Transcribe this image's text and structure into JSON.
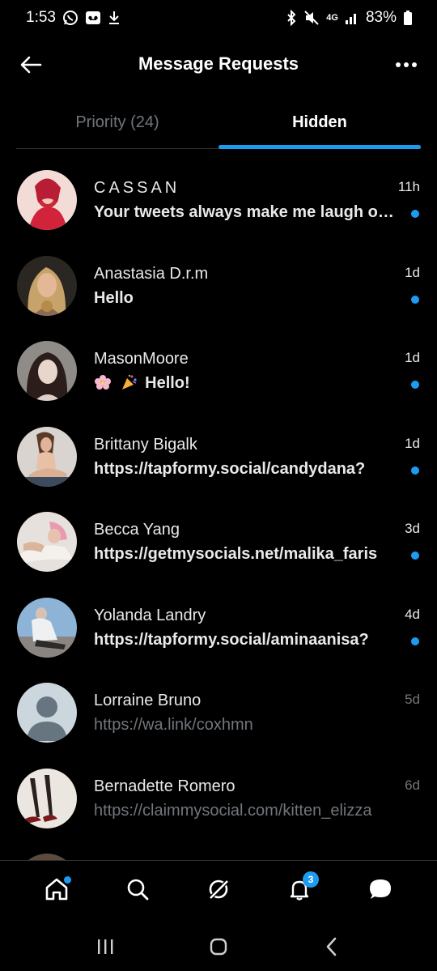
{
  "status_bar": {
    "time": "1:53",
    "network": "4G",
    "battery": "83%",
    "icons": [
      "whatsapp-icon",
      "voicemail-icon",
      "download-icon",
      "bluetooth-icon",
      "mute-icon",
      "signal-icon",
      "battery-icon"
    ]
  },
  "header": {
    "title": "Message Requests",
    "back_icon": "back-arrow-icon",
    "more_icon": "more-options-icon"
  },
  "tabs": [
    {
      "label": "Priority (24)",
      "active": false
    },
    {
      "label": "Hidden",
      "active": true
    }
  ],
  "requests": [
    {
      "name": "CASSAN",
      "time": "11h",
      "preview": "Your tweets always make me laugh out loud",
      "unread": true
    },
    {
      "name": "Anastasia D.r.m",
      "time": "1d",
      "preview": "Hello",
      "unread": true
    },
    {
      "name": "MasonMoore",
      "time": "1d",
      "preview": "Hello!",
      "unread": true,
      "emoji": [
        "cherry-blossom-icon",
        "party-popper-icon"
      ]
    },
    {
      "name": "Brittany Bigalk",
      "time": "1d",
      "preview": "https://tapformy.social/candydana?",
      "unread": true
    },
    {
      "name": "Becca Yang",
      "time": "3d",
      "preview": "https://getmysocials.net/malika_faris",
      "unread": true
    },
    {
      "name": "Yolanda Landry",
      "time": "4d",
      "preview": "https://tapformy.social/aminaanisa?",
      "unread": true
    },
    {
      "name": "Lorraine Bruno",
      "time": "5d",
      "preview": "https://wa.link/coxhmn",
      "unread": false
    },
    {
      "name": "Bernadette Romero",
      "time": "6d",
      "preview": "https://claimmysocial.com/kitten_elizza",
      "unread": false
    }
  ],
  "bottom_nav": {
    "items": [
      "home-icon",
      "search-icon",
      "grok-icon",
      "notifications-icon",
      "messages-icon"
    ],
    "notifications_count": "3"
  },
  "colors": {
    "accent": "#1d9bf0",
    "background": "#000000",
    "text": "#e7e9ea",
    "muted": "#71767b"
  }
}
